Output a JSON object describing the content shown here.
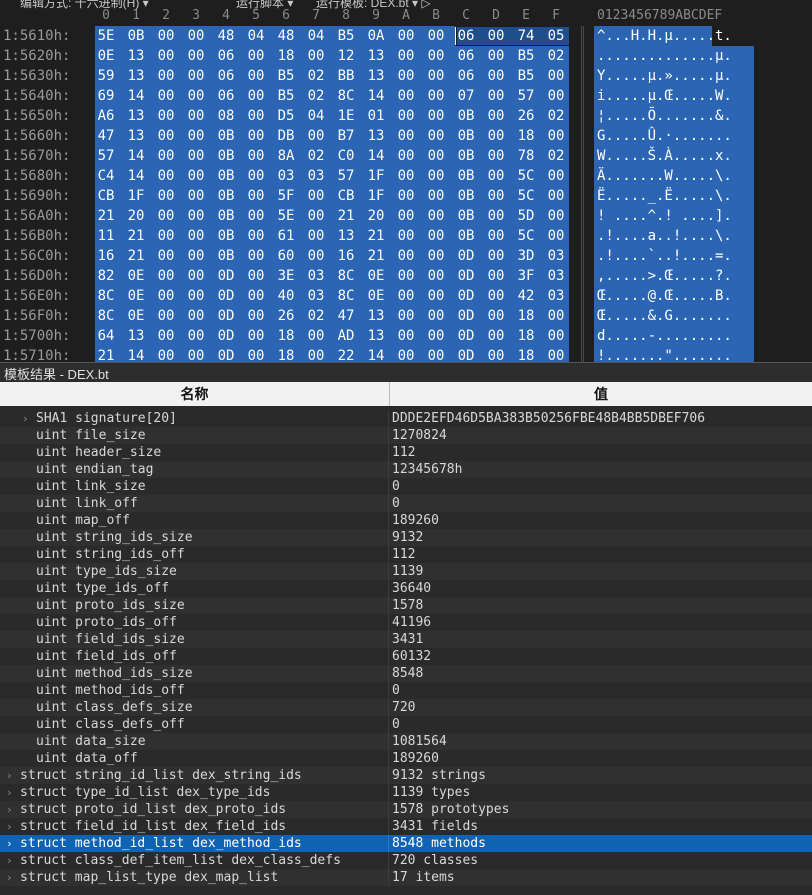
{
  "toolbar": {
    "edit_mode": "编辑方式: 十六进制(H) ▾",
    "run_script": "运行脚本 ▾",
    "run_template": "运行模板: DEX.bt ▾ ▷"
  },
  "hex": {
    "columns": [
      "0",
      "1",
      "2",
      "3",
      "4",
      "5",
      "6",
      "7",
      "8",
      "9",
      "A",
      "B",
      "C",
      "D",
      "E",
      "F"
    ],
    "ascii_header": "0123456789ABCDEF",
    "rows": [
      {
        "addr": "1:5610h:",
        "bytes": [
          "5E",
          "0B",
          "00",
          "00",
          "48",
          "04",
          "48",
          "04",
          "B5",
          "0A",
          "00",
          "00",
          "06",
          "00",
          "74",
          "05"
        ],
        "ascii": "^...H.H.µ.....t."
      },
      {
        "addr": "1:5620h:",
        "bytes": [
          "0E",
          "13",
          "00",
          "00",
          "06",
          "00",
          "18",
          "00",
          "12",
          "13",
          "00",
          "00",
          "06",
          "00",
          "B5",
          "02"
        ],
        "ascii": "..............µ."
      },
      {
        "addr": "1:5630h:",
        "bytes": [
          "59",
          "13",
          "00",
          "00",
          "06",
          "00",
          "B5",
          "02",
          "BB",
          "13",
          "00",
          "00",
          "06",
          "00",
          "B5",
          "00"
        ],
        "ascii": "Y.....µ.».....µ."
      },
      {
        "addr": "1:5640h:",
        "bytes": [
          "69",
          "14",
          "00",
          "00",
          "06",
          "00",
          "B5",
          "02",
          "8C",
          "14",
          "00",
          "00",
          "07",
          "00",
          "57",
          "00"
        ],
        "ascii": "i.....µ.Œ.....W."
      },
      {
        "addr": "1:5650h:",
        "bytes": [
          "A6",
          "13",
          "00",
          "00",
          "08",
          "00",
          "D5",
          "04",
          "1E",
          "01",
          "00",
          "00",
          "0B",
          "00",
          "26",
          "02"
        ],
        "ascii": "¦.....Õ.......&."
      },
      {
        "addr": "1:5660h:",
        "bytes": [
          "47",
          "13",
          "00",
          "00",
          "0B",
          "00",
          "DB",
          "00",
          "B7",
          "13",
          "00",
          "00",
          "0B",
          "00",
          "18",
          "00"
        ],
        "ascii": "G.....Û.·......."
      },
      {
        "addr": "1:5670h:",
        "bytes": [
          "57",
          "14",
          "00",
          "00",
          "0B",
          "00",
          "8A",
          "02",
          "C0",
          "14",
          "00",
          "00",
          "0B",
          "00",
          "78",
          "02"
        ],
        "ascii": "W.....Š.À.....x."
      },
      {
        "addr": "1:5680h:",
        "bytes": [
          "C4",
          "14",
          "00",
          "00",
          "0B",
          "00",
          "03",
          "03",
          "57",
          "1F",
          "00",
          "00",
          "0B",
          "00",
          "5C",
          "00"
        ],
        "ascii": "Ä.......W.....\\."
      },
      {
        "addr": "1:5690h:",
        "bytes": [
          "CB",
          "1F",
          "00",
          "00",
          "0B",
          "00",
          "5F",
          "00",
          "CB",
          "1F",
          "00",
          "00",
          "0B",
          "00",
          "5C",
          "00"
        ],
        "ascii": "Ë....._.Ë.....\\."
      },
      {
        "addr": "1:56A0h:",
        "bytes": [
          "21",
          "20",
          "00",
          "00",
          "0B",
          "00",
          "5E",
          "00",
          "21",
          "20",
          "00",
          "00",
          "0B",
          "00",
          "5D",
          "00"
        ],
        "ascii": "! ....^.! ....]."
      },
      {
        "addr": "1:56B0h:",
        "bytes": [
          "11",
          "21",
          "00",
          "00",
          "0B",
          "00",
          "61",
          "00",
          "13",
          "21",
          "00",
          "00",
          "0B",
          "00",
          "5C",
          "00"
        ],
        "ascii": ".!....a..!....\\."
      },
      {
        "addr": "1:56C0h:",
        "bytes": [
          "16",
          "21",
          "00",
          "00",
          "0B",
          "00",
          "60",
          "00",
          "16",
          "21",
          "00",
          "00",
          "0D",
          "00",
          "3D",
          "03"
        ],
        "ascii": ".!....`..!....=."
      },
      {
        "addr": "1:56D0h:",
        "bytes": [
          "82",
          "0E",
          "00",
          "00",
          "0D",
          "00",
          "3E",
          "03",
          "8C",
          "0E",
          "00",
          "00",
          "0D",
          "00",
          "3F",
          "03"
        ],
        "ascii": "‚.....>.Œ.....?."
      },
      {
        "addr": "1:56E0h:",
        "bytes": [
          "8C",
          "0E",
          "00",
          "00",
          "0D",
          "00",
          "40",
          "03",
          "8C",
          "0E",
          "00",
          "00",
          "0D",
          "00",
          "42",
          "03"
        ],
        "ascii": "Œ.....@.Œ.....B."
      },
      {
        "addr": "1:56F0h:",
        "bytes": [
          "8C",
          "0E",
          "00",
          "00",
          "0D",
          "00",
          "26",
          "02",
          "47",
          "13",
          "00",
          "00",
          "0D",
          "00",
          "18",
          "00"
        ],
        "ascii": "Œ.....&.G......."
      },
      {
        "addr": "1:5700h:",
        "bytes": [
          "64",
          "13",
          "00",
          "00",
          "0D",
          "00",
          "18",
          "00",
          "AD",
          "13",
          "00",
          "00",
          "0D",
          "00",
          "18",
          "00"
        ],
        "ascii": "d.....-........."
      },
      {
        "addr": "1:5710h:",
        "bytes": [
          "21",
          "14",
          "00",
          "00",
          "0D",
          "00",
          "18",
          "00",
          "22",
          "14",
          "00",
          "00",
          "0D",
          "00",
          "18",
          "00"
        ],
        "ascii": "!.......\"......."
      }
    ]
  },
  "template": {
    "title": "模板结果 - DEX.bt",
    "col_name": "名称",
    "col_value": "值",
    "rows": [
      {
        "name": "SHA1 signature[20]",
        "value": "DDDE2EFD46D5BA383B50256FBE48B4BB5DBEF706",
        "expandable": true,
        "indent": 1
      },
      {
        "name": "uint file_size",
        "value": "1270824",
        "indent": 2
      },
      {
        "name": "uint header_size",
        "value": "112",
        "indent": 2
      },
      {
        "name": "uint endian_tag",
        "value": "12345678h",
        "indent": 2
      },
      {
        "name": "uint link_size",
        "value": "0",
        "indent": 2
      },
      {
        "name": "uint link_off",
        "value": "0",
        "indent": 2
      },
      {
        "name": "uint map_off",
        "value": "189260",
        "indent": 2
      },
      {
        "name": "uint string_ids_size",
        "value": "9132",
        "indent": 2
      },
      {
        "name": "uint string_ids_off",
        "value": "112",
        "indent": 2
      },
      {
        "name": "uint type_ids_size",
        "value": "1139",
        "indent": 2
      },
      {
        "name": "uint type_ids_off",
        "value": "36640",
        "indent": 2
      },
      {
        "name": "uint proto_ids_size",
        "value": "1578",
        "indent": 2
      },
      {
        "name": "uint proto_ids_off",
        "value": "41196",
        "indent": 2
      },
      {
        "name": "uint field_ids_size",
        "value": "3431",
        "indent": 2
      },
      {
        "name": "uint field_ids_off",
        "value": "60132",
        "indent": 2
      },
      {
        "name": "uint method_ids_size",
        "value": "8548",
        "indent": 2
      },
      {
        "name": "uint method_ids_off",
        "value": "0",
        "indent": 2
      },
      {
        "name": "uint class_defs_size",
        "value": "720",
        "indent": 2
      },
      {
        "name": "uint class_defs_off",
        "value": "0",
        "indent": 2
      },
      {
        "name": "uint data_size",
        "value": "1081564",
        "indent": 2
      },
      {
        "name": "uint data_off",
        "value": "189260",
        "indent": 2
      },
      {
        "name": "struct string_id_list dex_string_ids",
        "value": "9132 strings",
        "expandable": true,
        "indent": 0
      },
      {
        "name": "struct type_id_list dex_type_ids",
        "value": "1139 types",
        "expandable": true,
        "indent": 0
      },
      {
        "name": "struct proto_id_list dex_proto_ids",
        "value": "1578 prototypes",
        "expandable": true,
        "indent": 0
      },
      {
        "name": "struct field_id_list dex_field_ids",
        "value": "3431 fields",
        "expandable": true,
        "indent": 0
      },
      {
        "name": "struct method_id_list dex_method_ids",
        "value": "8548 methods",
        "expandable": true,
        "indent": 0,
        "selected": true
      },
      {
        "name": "struct class_def_item_list dex_class_defs",
        "value": "720 classes",
        "expandable": true,
        "indent": 0
      },
      {
        "name": "struct map_list_type dex_map_list",
        "value": "17 items",
        "expandable": true,
        "indent": 0
      }
    ]
  },
  "colors": {
    "selection": "#2b65b3",
    "row_selected": "#0e63b5",
    "background": "#1e1e1e"
  }
}
